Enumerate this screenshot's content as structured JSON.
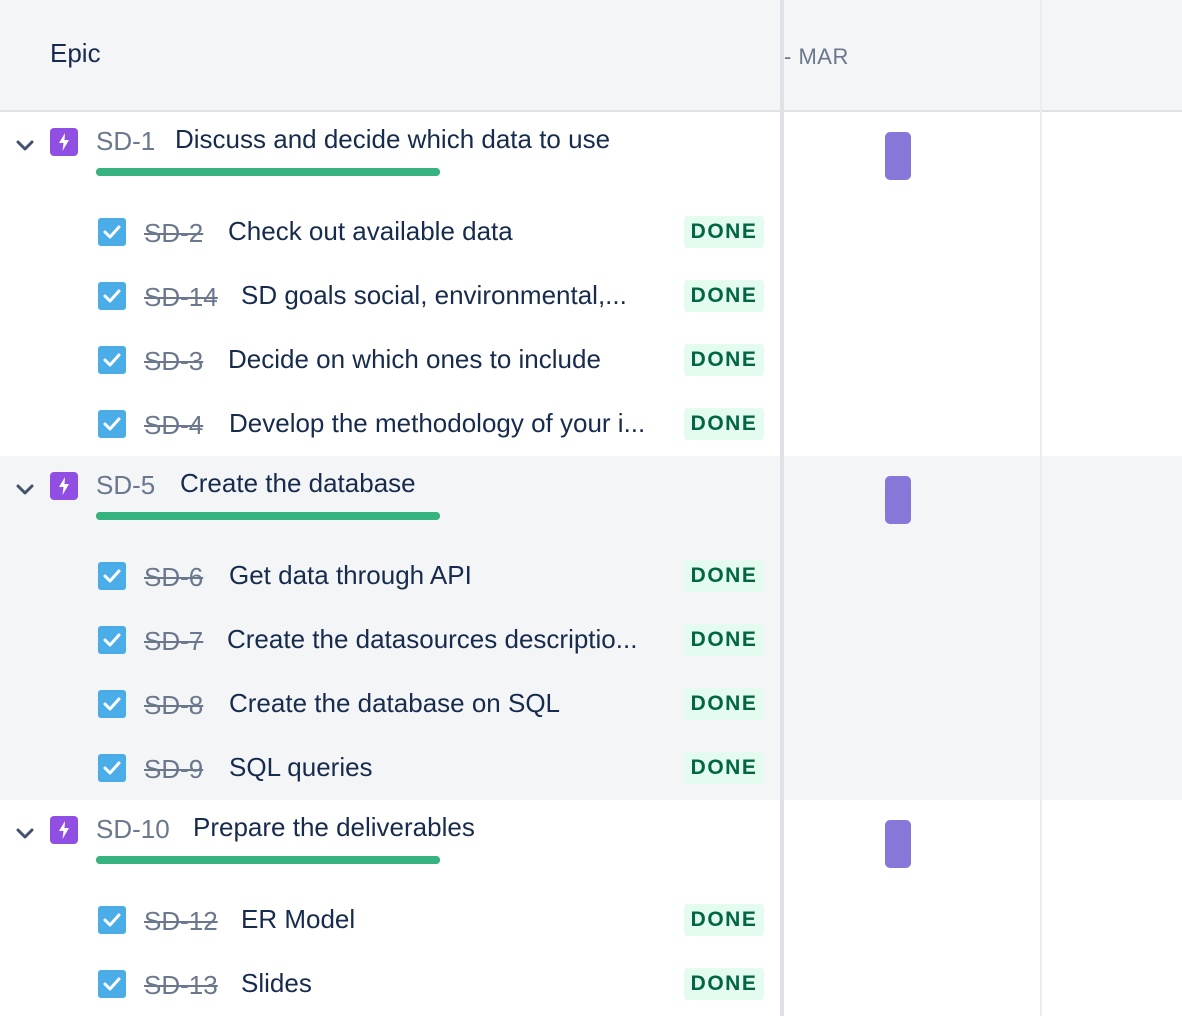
{
  "header": {
    "epic_heading": "Epic",
    "month_label": "- MAR"
  },
  "colors": {
    "epic_icon": "#904ee2",
    "progress": "#36b37e",
    "timeline_bar": "#8777d9",
    "checkbox": "#4bade8",
    "done_bg": "#e3fcef",
    "done_text": "#006644"
  },
  "icons": {
    "chevron": "chevron-down-icon",
    "epic": "lightning-bolt-icon",
    "task": "checkbox-checked-icon"
  },
  "epics": [
    {
      "key": "SD-1",
      "summary": "Discuss and decide which data to use",
      "progress": 1.0,
      "children": [
        {
          "key": "SD-2",
          "summary": "Check out available data",
          "status": "DONE"
        },
        {
          "key": "SD-14",
          "summary": "SD goals social, environmental,...",
          "status": "DONE"
        },
        {
          "key": "SD-3",
          "summary": "Decide on which ones to include",
          "status": "DONE"
        },
        {
          "key": "SD-4",
          "summary": "Develop the methodology of your i...",
          "status": "DONE"
        }
      ]
    },
    {
      "key": "SD-5",
      "summary": "Create the database",
      "progress": 1.0,
      "children": [
        {
          "key": "SD-6",
          "summary": "Get data through API",
          "status": "DONE"
        },
        {
          "key": "SD-7",
          "summary": "Create the datasources descriptio...",
          "status": "DONE"
        },
        {
          "key": "SD-8",
          "summary": "Create the database on SQL",
          "status": "DONE"
        },
        {
          "key": "SD-9",
          "summary": "SQL queries",
          "status": "DONE"
        }
      ]
    },
    {
      "key": "SD-10",
      "summary": "Prepare the deliverables",
      "progress": 1.0,
      "children": [
        {
          "key": "SD-12",
          "summary": "ER Model",
          "status": "DONE"
        },
        {
          "key": "SD-13",
          "summary": "Slides",
          "status": "DONE"
        }
      ]
    }
  ]
}
